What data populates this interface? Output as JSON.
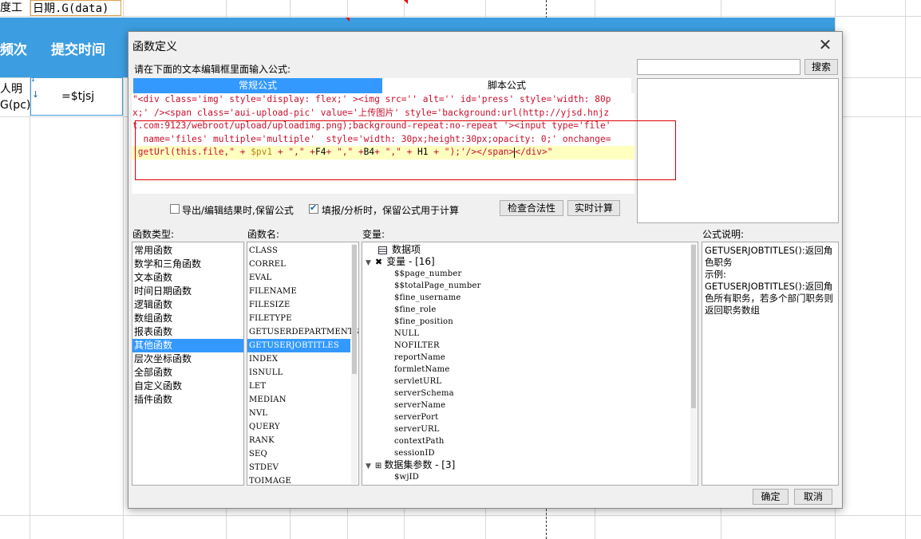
{
  "sheet": {
    "top_cell_label": "度工作",
    "top_cell_formula": "日期.G(data)",
    "header_col1": "频次",
    "header_col2": "提交时间",
    "row1_col1_line1": "人明",
    "row1_col1_line2": "G(pc)",
    "row1_col2": "=$tjsj",
    "header_color": "#3c9ee0"
  },
  "dialog": {
    "title": "函数定义",
    "close_icon": "close-icon",
    "instruction": "请在下面的文本编辑框里面输入公式:",
    "search_placeholder": "",
    "search_button": "搜索",
    "tabs": {
      "normal": "常规公式",
      "script": "脚本公式"
    },
    "formula_lines": [
      "\"<div class='img' style='display: flex;' ><img src='' alt='' id='press' style='width: 80p",
      "x;' /><span class='aui-upload-pic' value='上传图片' style='background:url(http://yjsd.hnjz",
      "t.com:9123/webroot/upload/uploadimg.png);background-repeat:no-repeat '><input type='file'",
      "  name='files' multiple='multiple'  style='width: 30px;height:30px;opacity: 0;' onchange="
    ],
    "formula_line5": {
      "p1": "'getUrl(this.file,\" + ",
      "p2": "$pv1",
      "p3": " + \",\" +",
      "p4": "F4",
      "p5": "+ \",\" +",
      "p6": "B4",
      "p7": "+ \",\" + ",
      "p8": "H1",
      "p9": " + \");'/></span>",
      "p10": "</div>\""
    },
    "options": {
      "keep_formula_label": "导出/编辑结果时,保留公式",
      "keep_formula_checked": false,
      "fill_calc_label": "填报/分析时，保留公式用于计算",
      "fill_calc_checked": true
    },
    "check_button": "检查合法性",
    "realtime_button": "实时计算",
    "function_types": {
      "label": "函数类型:",
      "items": [
        "常用函数",
        "数学和三角函数",
        "文本函数",
        "时间日期函数",
        "逻辑函数",
        "数组函数",
        "报表函数",
        "其他函数",
        "层次坐标函数",
        "全部函数",
        "自定义函数",
        "插件函数"
      ],
      "selected": "其他函数"
    },
    "function_names": {
      "label": "函数名:",
      "items": [
        "CLASS",
        "CORREL",
        "EVAL",
        "FILENAME",
        "FILESIZE",
        "FILETYPE",
        "GETUSERDEPARTMENTS",
        "GETUSERJOBTITLES",
        "INDEX",
        "ISNULL",
        "LET",
        "MEDIAN",
        "NVL",
        "QUERY",
        "RANK",
        "SEQ",
        "STDEV",
        "TOIMAGE"
      ],
      "selected": "GETUSERJOBTITLES"
    },
    "variables": {
      "label": "变量:",
      "data_items": "数据项",
      "variable_group": "变量 - [16]",
      "variable_items": [
        "$$page_number",
        "$$totalPage_number",
        "$fine_username",
        "$fine_role",
        "$fine_position",
        "NULL",
        "NOFILTER",
        "reportName",
        "formletName",
        "servletURL",
        "serverSchema",
        "serverName",
        "serverPort",
        "serverURL",
        "contextPath",
        "sessionID"
      ],
      "dataset_group": "数据集参数 - [3]",
      "dataset_items": [
        "$wjID"
      ]
    },
    "description": {
      "label": "公式说明:",
      "line1": "GETUSERJOBTITLES():返回角色职务",
      "line2": "示例:",
      "line3": "GETUSERJOBTITLES():返回角色所有职务，若多个部门职务则返回职务数组"
    },
    "ok_button": "确定",
    "cancel_button": "取消"
  }
}
